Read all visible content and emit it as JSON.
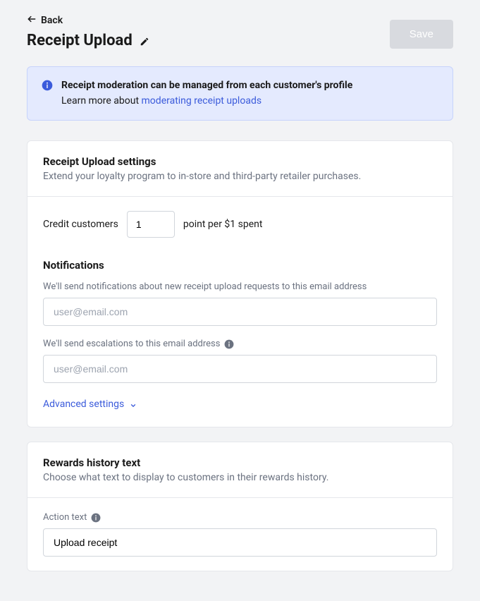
{
  "header": {
    "back_label": "Back",
    "title": "Receipt Upload",
    "save_label": "Save"
  },
  "banner": {
    "line1": "Receipt moderation can be managed from each customer's profile",
    "line2_prefix": "Learn more about ",
    "line2_link": "moderating receipt uploads"
  },
  "settings": {
    "title": "Receipt Upload settings",
    "subtitle": "Extend your loyalty program to in-store and third-party retailer purchases.",
    "credit_prefix": "Credit customers",
    "credit_points_value": "1",
    "credit_suffix": "point per $1 spent",
    "notifications_heading": "Notifications",
    "notification_email_label": "We'll send notifications about new receipt upload requests to this email address",
    "notification_email_placeholder": "user@email.com",
    "escalation_email_label": "We'll send escalations to this email address",
    "escalation_email_placeholder": "user@email.com",
    "advanced_label": "Advanced settings"
  },
  "rewards": {
    "title": "Rewards history text",
    "subtitle": "Choose what text to display to customers in their rewards history.",
    "action_text_label": "Action text",
    "action_text_value": "Upload receipt"
  }
}
